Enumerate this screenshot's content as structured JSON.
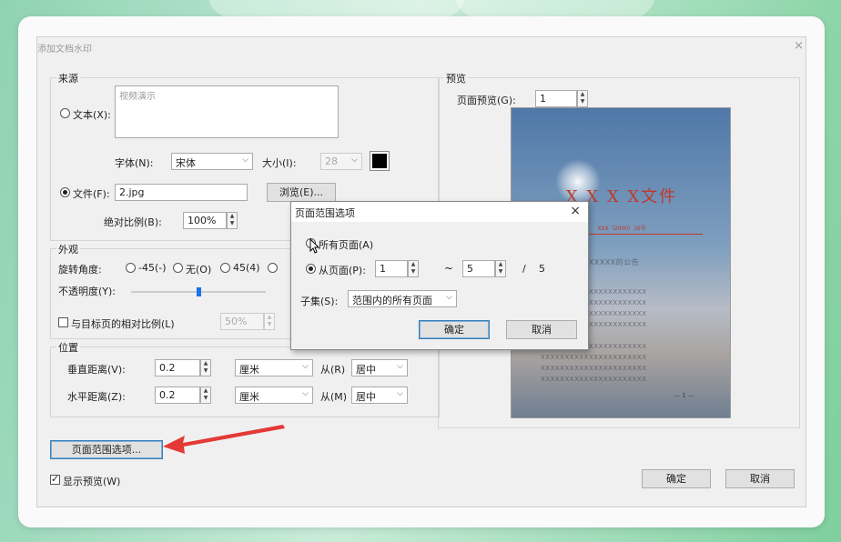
{
  "dialog": {
    "title": "添加文档水印",
    "close": "×"
  },
  "source": {
    "label": "来源",
    "text_radio": "文本(X):",
    "text_value": "视频演示",
    "font_label": "字体(N):",
    "font_value": "宋体",
    "size_label": "大小(I):",
    "size_value": "28",
    "file_radio": "文件(F):",
    "file_value": "2.jpg",
    "browse_button": "浏览(E)...",
    "scale_label": "绝对比例(B):",
    "scale_value": "100%"
  },
  "appearance": {
    "label": "外观",
    "rotation_label": "旋转角度:",
    "rot_neg45": "-45(-)",
    "rot_none": "无(O)",
    "rot_45": "45(4)",
    "opacity_label": "不透明度(Y):",
    "opacity_level": 0.5,
    "relative_label": "与目标页的相对比例(L)",
    "relative_value": "50%"
  },
  "position": {
    "label": "位置",
    "vertical_label": "垂直距离(V):",
    "vertical_value": "0.2",
    "vertical_unit": "厘米",
    "from_r_label": "从(R)",
    "from_r_value": "居中",
    "horizontal_label": "水平距离(Z):",
    "horizontal_value": "0.2",
    "horizontal_unit": "厘米",
    "from_m_label": "从(M)",
    "from_m_value": "居中"
  },
  "page_range_button": "页面范围选项...",
  "show_preview_label": "显示预览(W)",
  "ok_button": "确定",
  "cancel_button": "取消",
  "preview": {
    "label": "预览",
    "page_preview_label": "页面预览(G):",
    "page_preview_value": "1",
    "doc_title": "X X X X文件",
    "doc_number": "XXX〔2000〕16号",
    "doc_subject": "XXXXX关于XXXXXX的公告",
    "doc_line": "XXXXXXXXXXXXXXXXXXXXXX",
    "doc_footer": "— 1 —"
  },
  "popup": {
    "title": "页面范围选项",
    "close": "×",
    "all_pages": "所有页面(A)",
    "from_page": "从页面(P):",
    "from_value": "1",
    "tilde": "~",
    "to_value": "5",
    "slash": "/",
    "total": "5",
    "subset_label": "子集(S):",
    "subset_value": "范围内的所有页面",
    "ok": "确定",
    "cancel": "取消"
  },
  "colors": {
    "accent": "#1a73e8",
    "arrow": "#e53935",
    "doc_red": "#c0392b",
    "swatch": "#000000"
  }
}
